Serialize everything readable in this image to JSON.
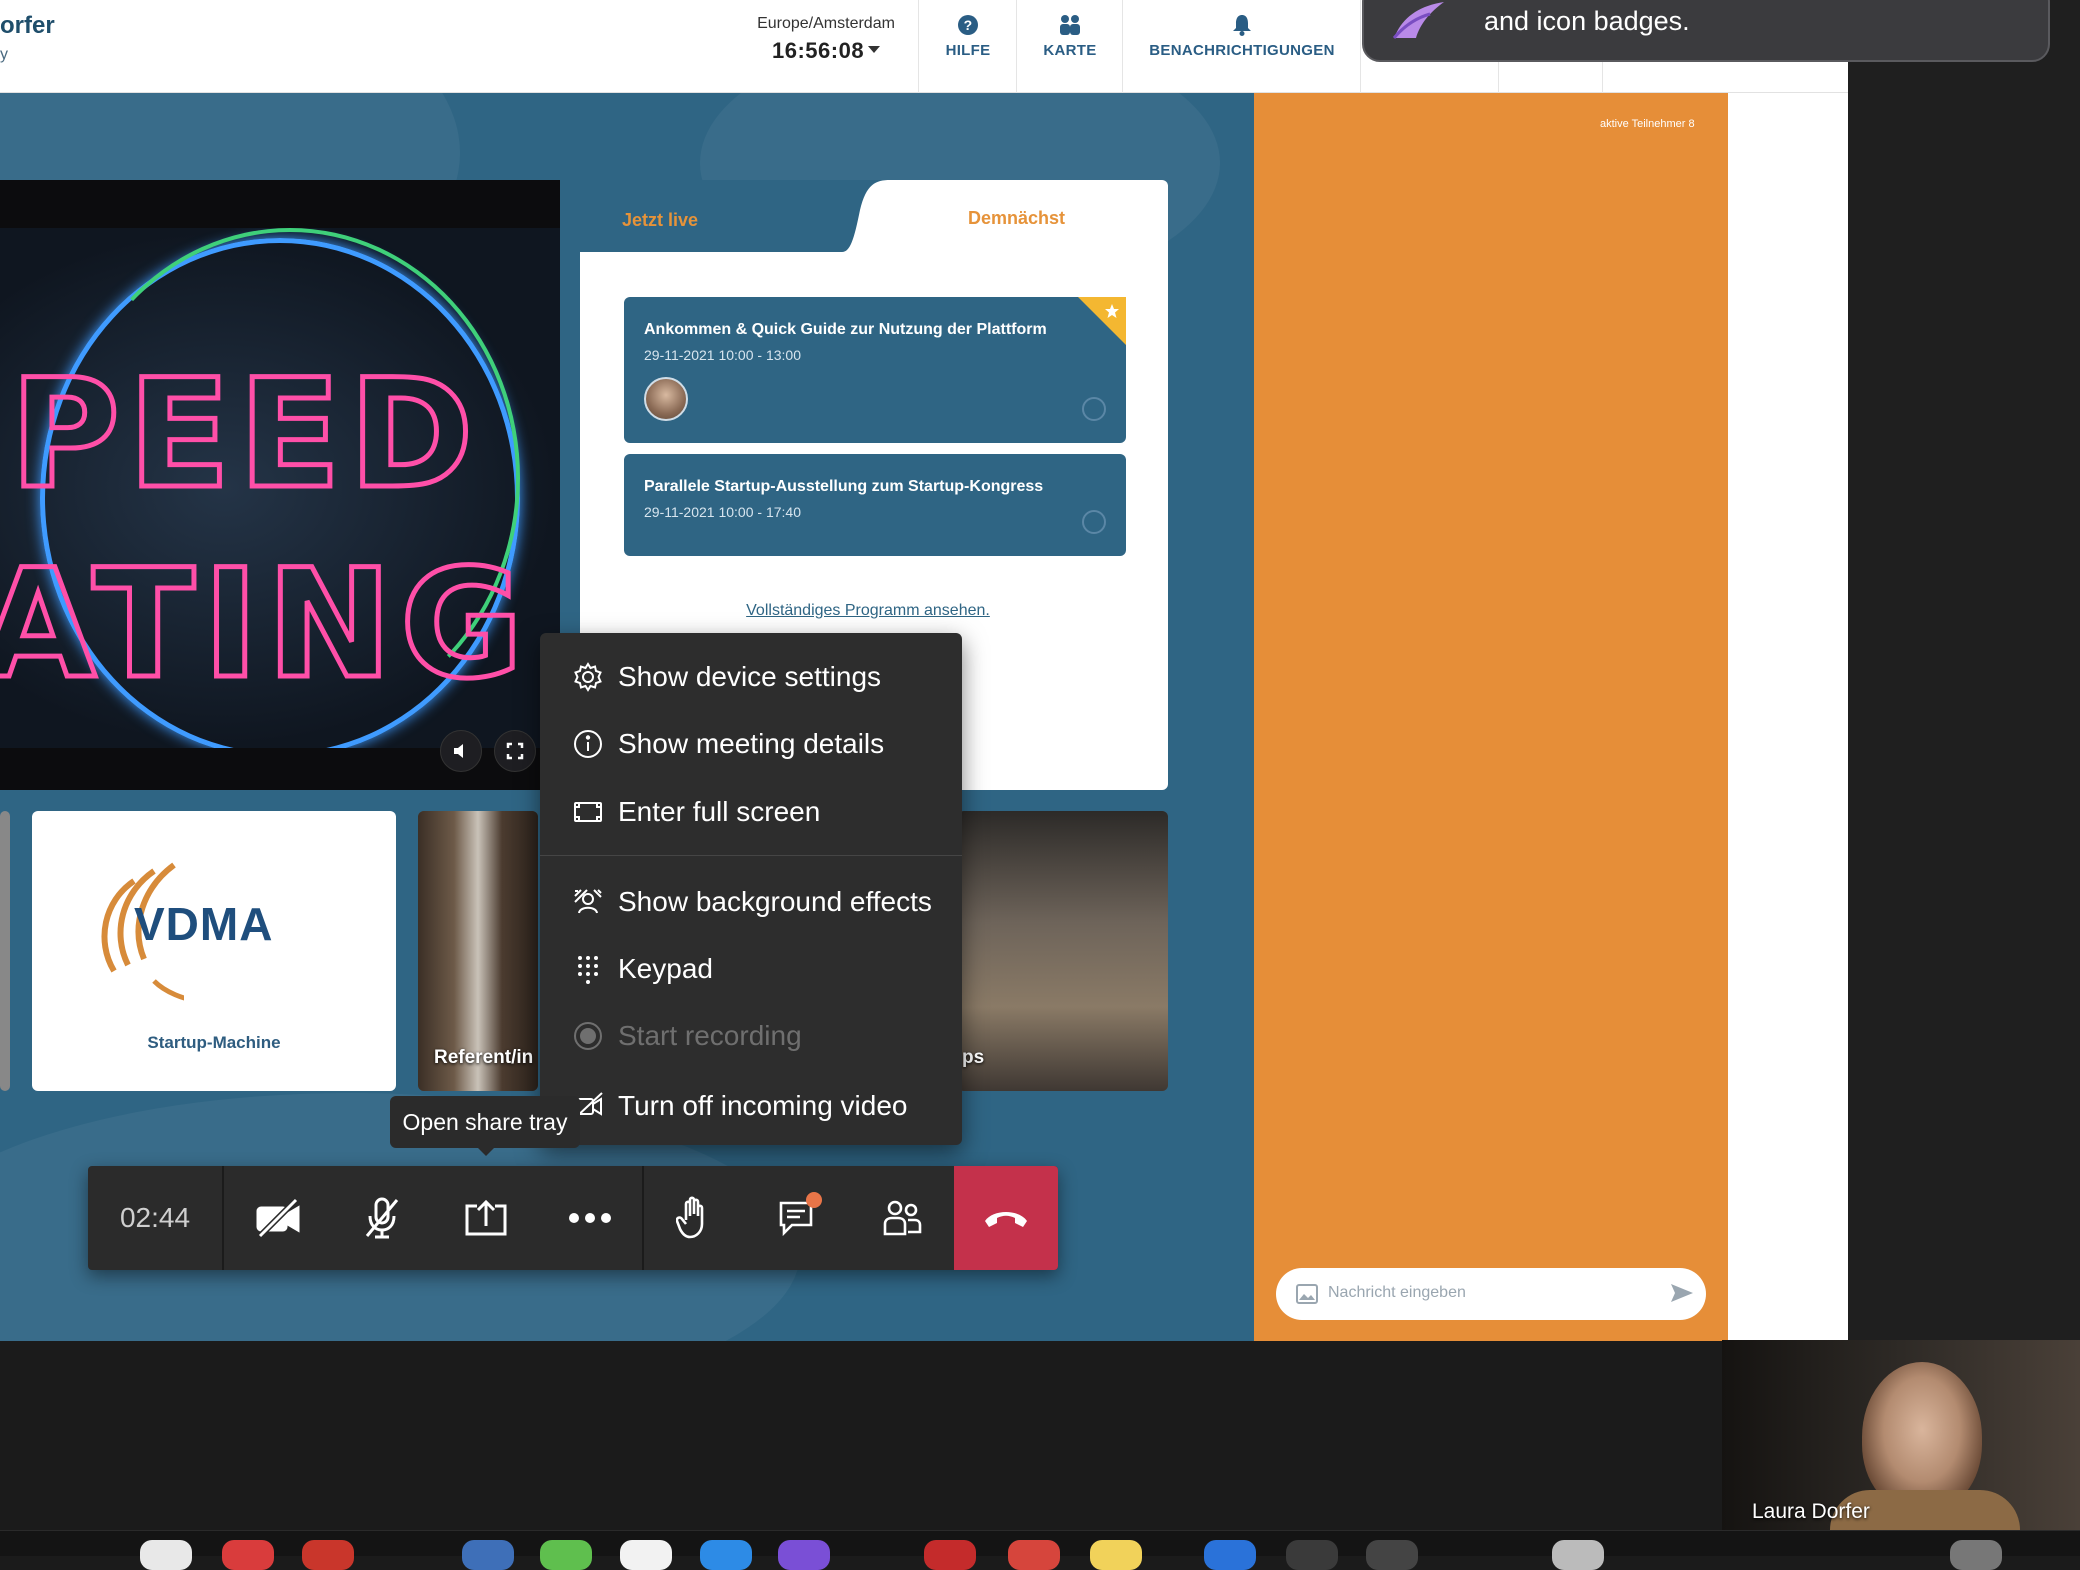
{
  "header": {
    "brand_name": "orfer",
    "brand_sub": "y",
    "timezone": "Europe/Amsterdam",
    "clock": "16:56:08",
    "nav": {
      "help": "HILFE",
      "map": "KARTE",
      "notifications": "BENACHRICHTIGUNGEN"
    }
  },
  "toast": {
    "text": "and icon badges."
  },
  "program": {
    "tab_live": "Jetzt live",
    "tab_soon": "Demnächst",
    "events": [
      {
        "title": "Ankommen & Quick Guide zur Nutzung der Plattform",
        "date": "29-11-2021 10:00 - 13:00"
      },
      {
        "title": "Parallele Startup-Ausstellung zum Startup-Kongress",
        "date": "29-11-2021 10:00 - 17:40"
      }
    ],
    "full_program_link": "Vollständiges Programm ansehen."
  },
  "tiles": {
    "vdma_logo": "VDMA",
    "vdma_sub": "Startup-Machine",
    "referent": "Referent/in",
    "right_partial": "ps"
  },
  "chat": {
    "participants": "aktive Teilnehmer  8",
    "placeholder": "Nachricht eingeben"
  },
  "menu": {
    "items": [
      {
        "label": "Show device settings",
        "icon": "gear-icon",
        "disabled": false
      },
      {
        "label": "Show meeting details",
        "icon": "info-icon",
        "disabled": false
      },
      {
        "label": "Enter full screen",
        "icon": "fullscreen-icon",
        "disabled": false
      },
      {
        "label": "Show background effects",
        "icon": "background-effects-icon",
        "disabled": false
      },
      {
        "label": "Keypad",
        "icon": "keypad-icon",
        "disabled": false
      },
      {
        "label": "Start recording",
        "icon": "record-icon",
        "disabled": true
      },
      {
        "label": "Turn off incoming video",
        "icon": "video-off-icon",
        "disabled": false
      }
    ]
  },
  "tooltip": "Open share tray",
  "callbar": {
    "timer": "02:44"
  },
  "selfview": {
    "name": "Laura Dorfer"
  },
  "colors": {
    "stage": "#2f6584",
    "chat_panel": "#e68e38",
    "accent_orange": "#e6933a",
    "hangup": "#c4314b",
    "menu_bg": "#2d2d2d"
  }
}
